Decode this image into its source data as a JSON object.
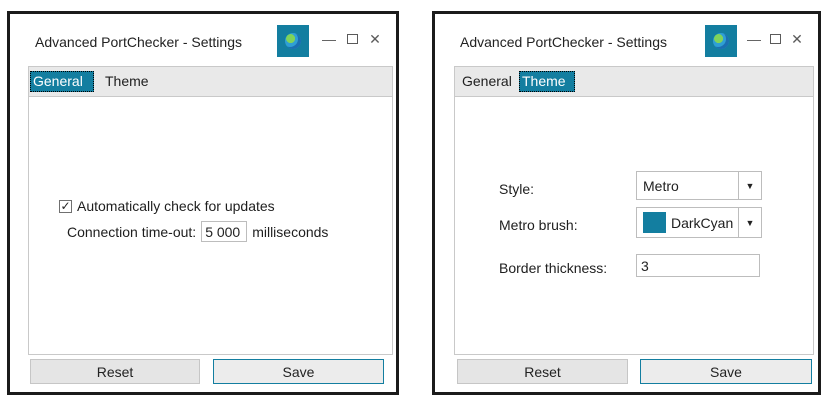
{
  "windows": [
    {
      "title": "Advanced PortChecker - Settings",
      "tabs": [
        "General",
        "Theme"
      ],
      "active_tab": "General",
      "general": {
        "auto_update_label": "Automatically check for updates",
        "auto_update_checked": true,
        "timeout_label": "Connection time-out:",
        "timeout_value": "5 000",
        "timeout_unit": "milliseconds"
      },
      "buttons": {
        "reset": "Reset",
        "save": "Save"
      }
    },
    {
      "title": "Advanced PortChecker - Settings",
      "tabs": [
        "General",
        "Theme"
      ],
      "active_tab": "Theme",
      "theme": {
        "style_label": "Style:",
        "style_value": "Metro",
        "brush_label": "Metro brush:",
        "brush_value": "DarkCyan",
        "brush_color": "#137ea0",
        "border_label": "Border thickness:",
        "border_value": "3"
      },
      "buttons": {
        "reset": "Reset",
        "save": "Save"
      }
    }
  ],
  "icons": {
    "app": "globe-icon",
    "minimize": "minimize-icon",
    "maximize": "maximize-icon",
    "close": "close-icon"
  },
  "colors": {
    "accent": "#137ea0"
  }
}
